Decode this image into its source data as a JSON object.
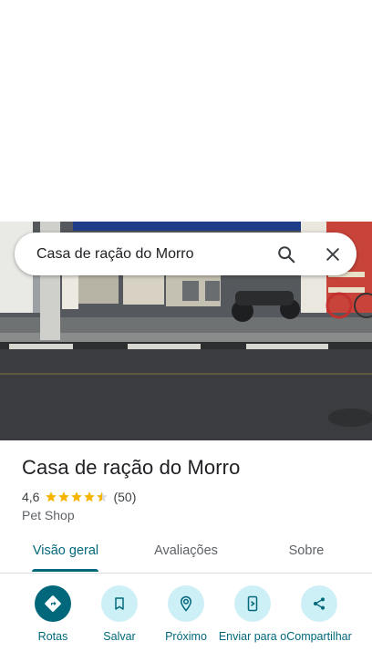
{
  "search": {
    "value": "Casa de ração do Morro",
    "search_icon": "search-icon",
    "close_icon": "close-icon"
  },
  "place": {
    "name": "Casa de ração do Morro",
    "rating": "4,6",
    "stars": 4.5,
    "reviews": "(50)",
    "category": "Pet Shop"
  },
  "tabs": [
    {
      "label": "Visão geral",
      "active": true
    },
    {
      "label": "Avaliações",
      "active": false
    },
    {
      "label": "Sobre",
      "active": false
    }
  ],
  "actions": [
    {
      "label": "Rotas",
      "icon": "directions-icon"
    },
    {
      "label": "Salvar",
      "icon": "bookmark-icon"
    },
    {
      "label": "Próximo",
      "icon": "nearby-icon"
    },
    {
      "label": "Enviar para o",
      "icon": "send-to-phone-icon"
    },
    {
      "label": "Compartilhar",
      "icon": "share-icon"
    }
  ],
  "colors": {
    "accent": "#00687a",
    "chip": "#cdeff6",
    "star": "#f4b400"
  }
}
